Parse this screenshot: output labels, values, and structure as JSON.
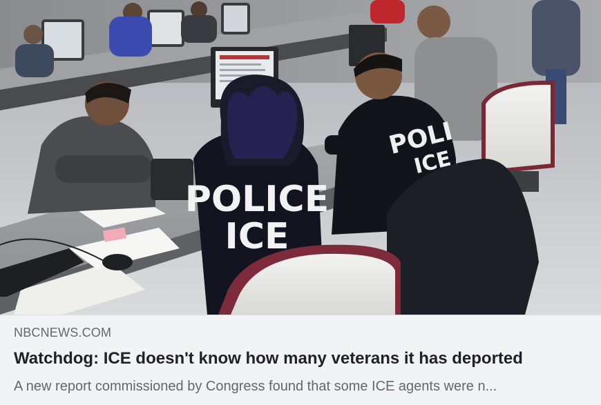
{
  "link_preview": {
    "domain": "NBCNEWS.COM",
    "headline": "Watchdog: ICE doesn't know how many veterans it has deported",
    "description": "A new report commissioned by Congress found that some ICE agents were n..."
  },
  "photo": {
    "jacket_text_left_line1": "POLICE",
    "jacket_text_left_line2": "ICE",
    "jacket_text_right_line1": "POLI",
    "jacket_text_right_line2": "ICE"
  },
  "colors": {
    "caption_background": "#f2f3f5",
    "domain_text": "#606770",
    "headline_text": "#1d2129",
    "description_text": "#606770"
  }
}
